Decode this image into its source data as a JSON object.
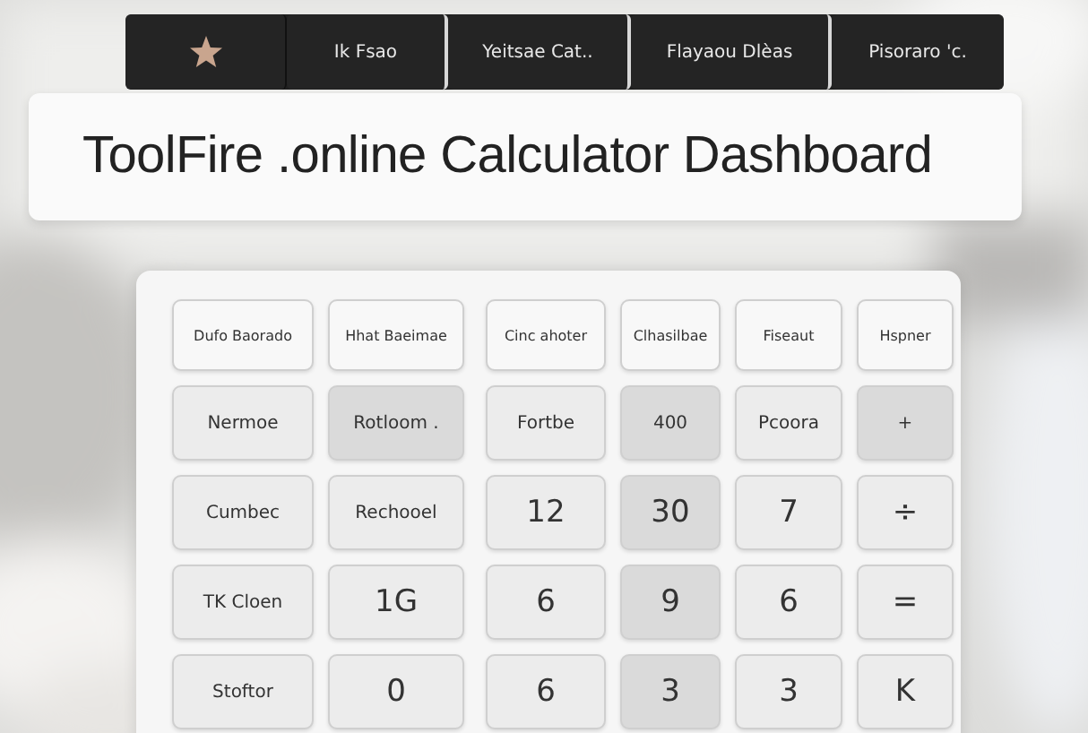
{
  "nav": {
    "items": [
      "Ik Fsao",
      "Yeitsae Cat..",
      "Flayaou Dlèas",
      "Pisoraro 'c."
    ]
  },
  "title": "ToolFire .online Calculator Dashboard",
  "keypad": {
    "rows": [
      [
        {
          "label": "Dufo Baorado",
          "kind": "small"
        },
        {
          "label": "Hhat Baeimae",
          "kind": "small"
        },
        {
          "label": "Cinc ahoter",
          "kind": "small"
        },
        {
          "label": "Clhasilbae",
          "kind": "small"
        },
        {
          "label": "Fiseaut",
          "kind": "small"
        },
        {
          "label": "Hspner",
          "kind": "small"
        }
      ],
      [
        {
          "label": "Nermoe",
          "kind": "light"
        },
        {
          "label": "Rotloom .",
          "kind": "dark"
        },
        {
          "label": "Fortbe",
          "kind": "light"
        },
        {
          "label": "400",
          "kind": "dark"
        },
        {
          "label": "Pcoora",
          "kind": "light"
        },
        {
          "label": "+",
          "kind": "dark"
        }
      ],
      [
        {
          "label": "Cumbec",
          "kind": "light"
        },
        {
          "label": "Rechooel",
          "kind": "light"
        },
        {
          "label": "12",
          "kind": "light"
        },
        {
          "label": "30",
          "kind": "dark"
        },
        {
          "label": "7",
          "kind": "light"
        },
        {
          "label": "÷",
          "kind": "light"
        }
      ],
      [
        {
          "label": "TK Cloen",
          "kind": "light"
        },
        {
          "label": "1G",
          "kind": "light"
        },
        {
          "label": "6",
          "kind": "light"
        },
        {
          "label": "9",
          "kind": "dark"
        },
        {
          "label": "6",
          "kind": "light"
        },
        {
          "label": "=",
          "kind": "light"
        }
      ],
      [
        {
          "label": "Stoftor",
          "kind": "light"
        },
        {
          "label": "0",
          "kind": "light"
        },
        {
          "label": "6",
          "kind": "light"
        },
        {
          "label": "3",
          "kind": "dark"
        },
        {
          "label": "3",
          "kind": "light"
        },
        {
          "label": "K",
          "kind": "light"
        }
      ]
    ]
  }
}
